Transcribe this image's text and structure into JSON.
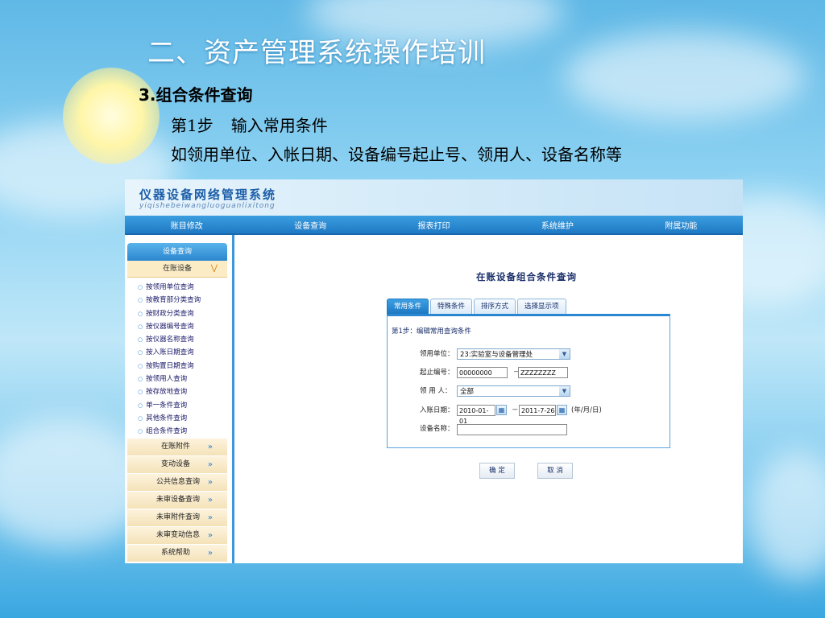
{
  "slide": {
    "title": "二、资产管理系统操作培训",
    "section": "3.组合条件查询",
    "step_label": "第1步",
    "step_text": "输入常用条件",
    "description": "如领用单位、入帐日期、设备编号起止号、领用人、设备名称等"
  },
  "app": {
    "title": "仪器设备网络管理系统",
    "pinyin": "yiqishebeiwangluoguanlixitong",
    "nav": [
      "账目修改",
      "设备查询",
      "报表打印",
      "系统维护",
      "附属功能"
    ],
    "sidebar": {
      "header": "设备查询",
      "subheader": "在账设备",
      "items": [
        "按领用单位查询",
        "按教育部分类查询",
        "按财政分类查询",
        "按仪器编号查询",
        "按仪器名称查询",
        "按入账日期查询",
        "按购置日期查询",
        "按领用人查询",
        "按存放地查询",
        "单一条件查询",
        "其他条件查询",
        "组合条件查询"
      ],
      "groups": [
        "在账附件",
        "变动设备",
        "公共信息查询",
        "未审设备查询",
        "未审附件查询",
        "未审变动信息",
        "系统帮助"
      ]
    },
    "main": {
      "title": "在账设备组合条件查询",
      "tabs": [
        "常用条件",
        "特殊条件",
        "排序方式",
        "选择显示项"
      ],
      "step": "第1步：编辑常用查询条件",
      "fields": {
        "unit_label": "领用单位：",
        "unit_value": "23:实验室与设备管理处",
        "code_label": "起止编号：",
        "code_from": "00000000",
        "code_sep": "－",
        "code_to": "ZZZZZZZZ",
        "user_label": "领 用 人：",
        "user_value": "全部",
        "date_label": "入账日期：",
        "date_from": "2010-01-01",
        "date_sep": "－",
        "date_to": "2011-7-26",
        "date_hint": "(年/月/日)",
        "name_label": "设备名称："
      },
      "buttons": {
        "ok": "确 定",
        "cancel": "取 消"
      }
    }
  }
}
